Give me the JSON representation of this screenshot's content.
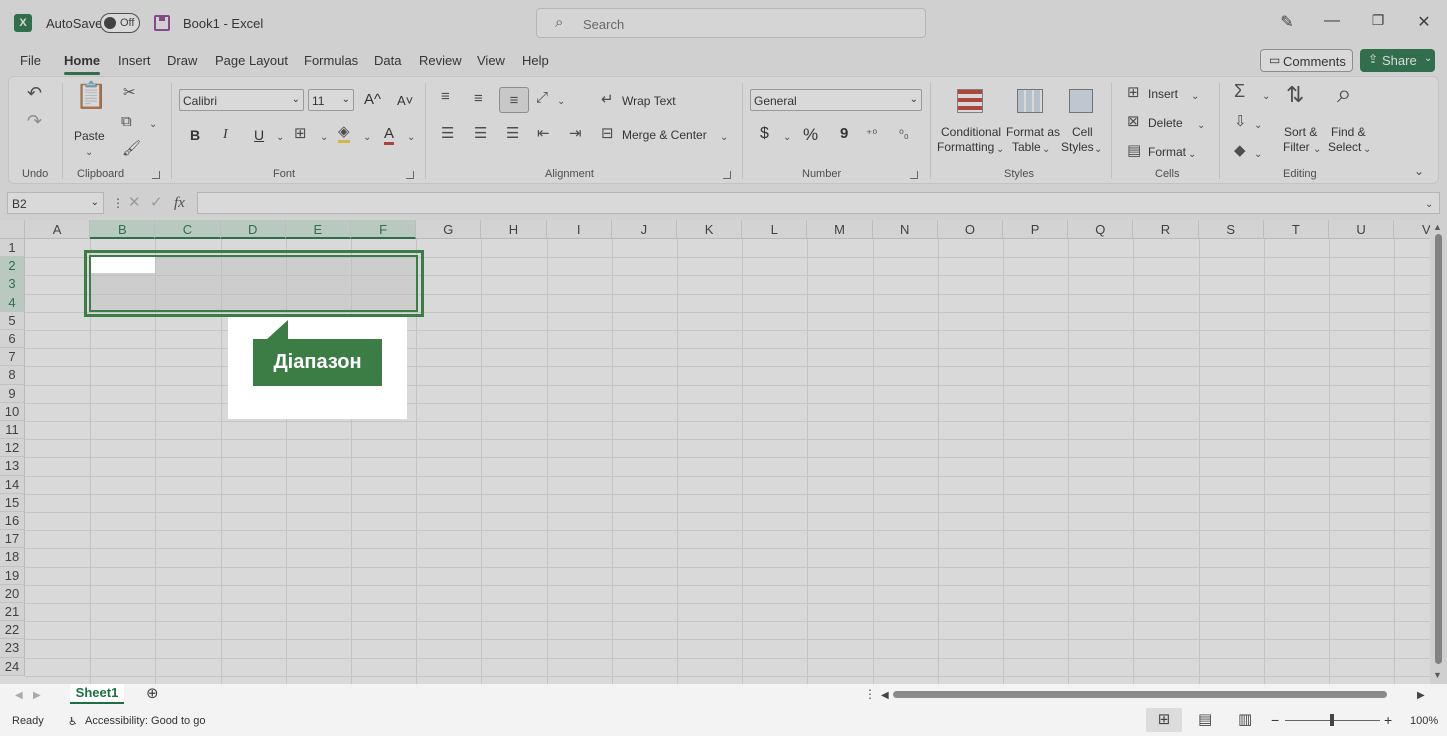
{
  "titlebar": {
    "logo": "X",
    "autosave_label": "AutoSave",
    "autosave_state": "Off",
    "doc_title": "Book1  -  Excel",
    "search_placeholder": "Search"
  },
  "menu": {
    "tabs": [
      "File",
      "Home",
      "Insert",
      "Draw",
      "Page Layout",
      "Formulas",
      "Data",
      "Review",
      "View",
      "Help"
    ],
    "active_tab": "Home",
    "comments_label": "Comments",
    "share_label": "Share"
  },
  "ribbon": {
    "undo_label": "Undo",
    "paste_label": "Paste",
    "clipboard_label": "Clipboard",
    "font_name": "Calibri",
    "font_size": "11",
    "font_label": "Font",
    "bold": "B",
    "italic": "I",
    "underline": "U",
    "font_color_glyph": "A",
    "grow_glyph": "A^",
    "shrink_glyph": "A˅",
    "wrap_text": "Wrap Text",
    "merge_center": "Merge & Center",
    "alignment_label": "Alignment",
    "number_format": "General",
    "currency_glyph": "$",
    "percent_glyph": "%",
    "comma_glyph": "9",
    "number_label": "Number",
    "cond_fmt_line1": "Conditional",
    "cond_fmt_line2": "Formatting",
    "format_table_line1": "Format as",
    "format_table_line2": "Table",
    "cell_styles_line1": "Cell",
    "cell_styles_line2": "Styles",
    "styles_label": "Styles",
    "insert_label": "Insert",
    "delete_label": "Delete",
    "format_label": "Format",
    "cells_label": "Cells",
    "sort_line1": "Sort &",
    "sort_line2": "Filter",
    "find_line1": "Find &",
    "find_line2": "Select",
    "editing_label": "Editing"
  },
  "formula_bar": {
    "name_box": "B2",
    "fx": "fx",
    "value": ""
  },
  "grid": {
    "columns": [
      "A",
      "B",
      "C",
      "D",
      "E",
      "F",
      "G",
      "H",
      "I",
      "J",
      "K",
      "L",
      "M",
      "N",
      "O",
      "P",
      "Q",
      "R",
      "S",
      "T",
      "U",
      "V"
    ],
    "rows": [
      "1",
      "2",
      "3",
      "4",
      "5",
      "6",
      "7",
      "8",
      "9",
      "10",
      "11",
      "12",
      "13",
      "14",
      "15",
      "16",
      "17",
      "18",
      "19",
      "20",
      "21",
      "22",
      "23",
      "24"
    ],
    "selected_columns": [
      "B",
      "C",
      "D",
      "E",
      "F"
    ],
    "selected_rows": [
      "2",
      "3",
      "4"
    ]
  },
  "callout": {
    "text": "Діапазон",
    "color": "#3b7d44"
  },
  "sheets": {
    "active": "Sheet1"
  },
  "status": {
    "ready": "Ready",
    "accessibility": "Accessibility: Good to go",
    "zoom": "100%"
  },
  "colors": {
    "accent": "#1d6f42"
  }
}
